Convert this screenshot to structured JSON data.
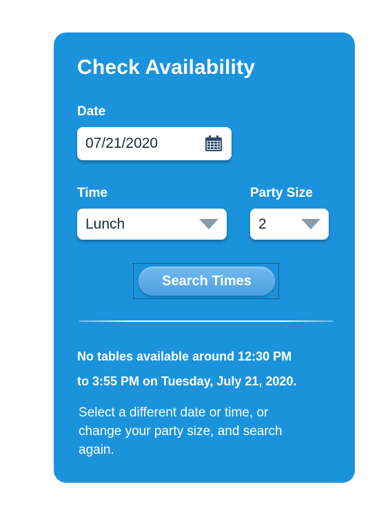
{
  "panel": {
    "title": "Check Availability",
    "date": {
      "label": "Date",
      "value": "07/21/2020",
      "icon": "calendar-icon"
    },
    "time": {
      "label": "Time",
      "selected": "Lunch",
      "icon": "dropdown-caret-icon"
    },
    "party_size": {
      "label": "Party Size",
      "selected": "2",
      "icon": "dropdown-caret-icon"
    },
    "search_button": "Search Times",
    "notice_lines": [
      "No tables available around 12:30 PM",
      "to 3:55 PM on Tuesday, July 21, 2020."
    ],
    "hint_lines": [
      "Select a different date or time, or",
      "change your party size, and search",
      "again."
    ]
  },
  "colors": {
    "panel_background": "#1b93dc",
    "button_top": "#74baf0",
    "button_bottom": "#4a9fe1",
    "field_text": "#1b2a36",
    "caret": "#8a9aa6",
    "calendar_icon": "#2e4a6b"
  }
}
